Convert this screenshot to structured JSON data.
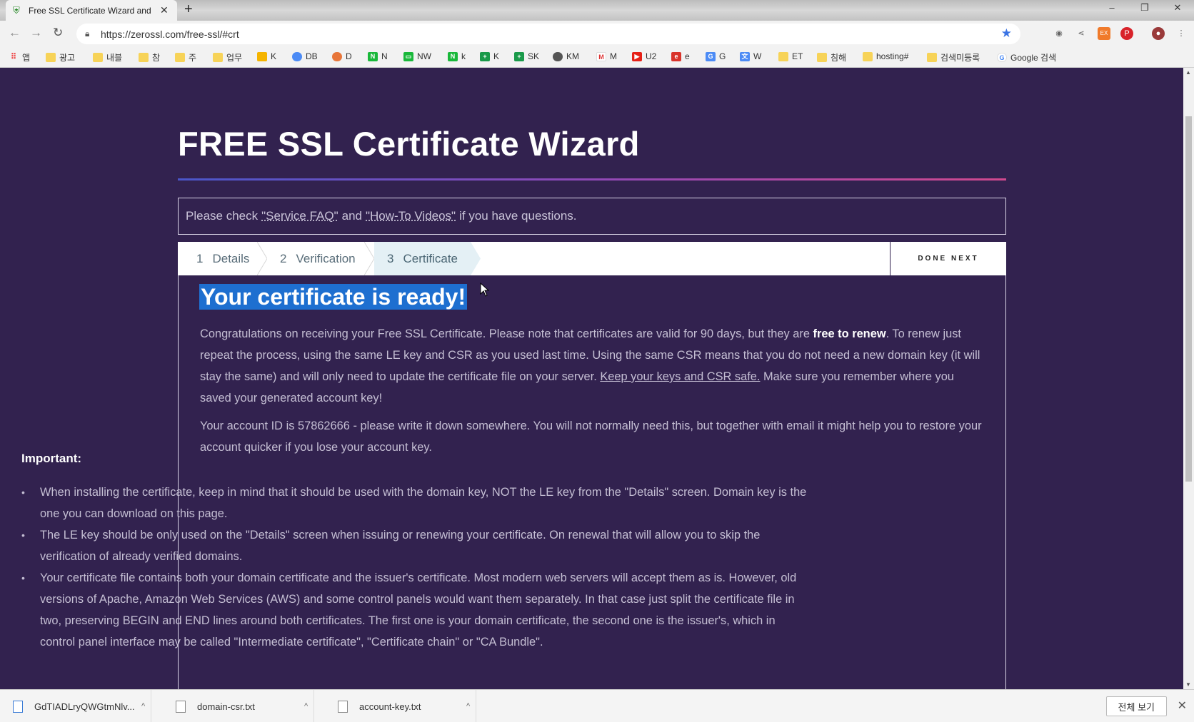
{
  "browser": {
    "tab_title": "Free SSL Certificate Wizard and",
    "new_tab": "+",
    "url": "https://zerossl.com/free-ssl/#crt",
    "window_controls": [
      "–",
      "❐",
      "✕"
    ],
    "bookmarks": [
      "앱",
      "광고",
      "내블",
      "참",
      "주",
      "업무",
      "K",
      "DB",
      "D",
      "N",
      "NW",
      "k",
      "K",
      "SK",
      "KM",
      "M",
      "U2",
      "e",
      "G",
      "W",
      "ET",
      "침해",
      "hosting#",
      "검색미등록",
      "Google 검색"
    ]
  },
  "page": {
    "title": "FREE SSL Certificate Wizard",
    "notice": {
      "prefix": "Please check",
      "faq_link": "\"Service FAQ\"",
      "and": "and",
      "videos_link": "\"How-To Videos\"",
      "suffix": "if you have questions."
    },
    "steps": [
      {
        "num": "1",
        "label": "Details"
      },
      {
        "num": "2",
        "label": "Verification"
      },
      {
        "num": "3",
        "label": "Certificate"
      }
    ],
    "done_next": "DONE NEXT",
    "ready_heading": "Your certificate is ready!",
    "para1": {
      "part1": "Congratulations on receiving your Free SSL Certificate. Please note that certificates are valid for 90 days, but they are ",
      "bold": "free to renew",
      "part2": ". To renew just repeat the process, using the same LE key and CSR as you used last time. Using the same CSR means that you do not need a new domain key (it will stay the same) and will only need to update the certificate file on your server. ",
      "link": "Keep your keys and CSR safe.",
      "part3": " Make sure you remember where you saved your generated account key!"
    },
    "para2": "Your account ID is 57862666 - please write it down somewhere. You will not normally need this, but together with email it might help you to restore your account quicker if you lose your account key.",
    "important_label": "Important:",
    "important_items": [
      "When installing the certificate, keep in mind that it should be used with the domain key, NOT the LE key from the \"Details\" screen. Domain key is the one you can download on this page.",
      "The LE key should be only used on the \"Details\" screen when issuing or renewing your certificate. On renewal that will allow you to skip the verification of already verified domains.",
      "Your certificate file contains both your domain certificate and the issuer's certificate. Most modern web servers will accept them as is. However, old versions of Apache, Amazon Web Services (AWS) and some control panels would want them separately. In that case just split the certificate file in two, preserving BEGIN and END lines around both certificates. The first one is your domain certificate, the second one is the issuer's, which in control panel interface may be called \"Intermediate certificate\", \"Certificate chain\" or \"CA Bundle\"."
    ]
  },
  "downloads": {
    "files": [
      "GdTIADLryQWGtmNlv...",
      "domain-csr.txt",
      "account-key.txt"
    ],
    "show_all": "전체 보기"
  }
}
